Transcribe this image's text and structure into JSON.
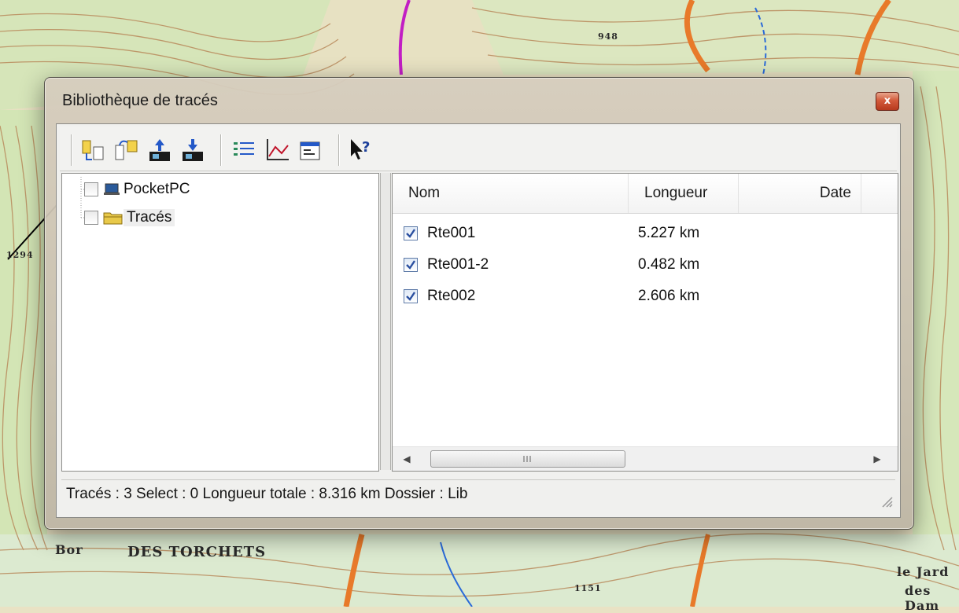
{
  "window": {
    "title": "Bibliothèque de tracés",
    "close_glyph": "x"
  },
  "toolbar": {
    "buttons": [
      {
        "name": "new-folder-icon"
      },
      {
        "name": "copy-folder-icon"
      },
      {
        "name": "upload-to-device-icon"
      },
      {
        "name": "download-from-device-icon"
      },
      {
        "name": "list-view-icon"
      },
      {
        "name": "profile-chart-icon"
      },
      {
        "name": "properties-icon"
      },
      {
        "name": "context-help-icon"
      }
    ]
  },
  "tree": {
    "items": [
      {
        "label": "PocketPC",
        "icon": "device-icon"
      },
      {
        "label": "Tracés",
        "icon": "folder-icon"
      }
    ]
  },
  "list": {
    "columns": [
      "Nom",
      "Longueur",
      "Date"
    ],
    "rows": [
      {
        "name": "Rte001",
        "length": "5.227 km",
        "date": ""
      },
      {
        "name": "Rte001-2",
        "length": "0.482 km",
        "date": ""
      },
      {
        "name": "Rte002",
        "length": "2.606 km",
        "date": ""
      }
    ]
  },
  "status": {
    "text": "Tracés : 3 Select : 0 Longueur totale : 8.316 km Dossier : Lib"
  },
  "map_labels": {
    "label_1": "DES TORCHETS",
    "label_2": "le Jard",
    "label_3": "des Dam",
    "label_4": "1294",
    "label_5": "Bor",
    "label_6": "948",
    "label_7": "1151"
  },
  "colors": {
    "map_bg": "#e9e2c4",
    "contour": "#b8845a",
    "forest": "#cfe3b3",
    "road_orange": "#e87a2a",
    "path_blue": "#2a6ad8",
    "close_red": "#c9462a"
  }
}
